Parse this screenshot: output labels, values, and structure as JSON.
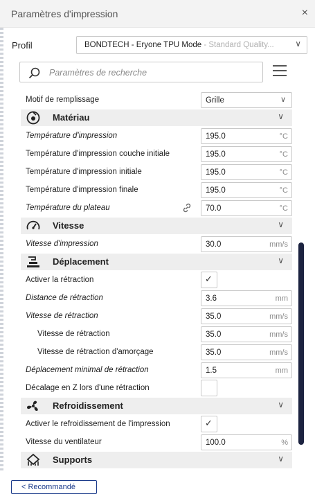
{
  "window": {
    "title": "Paramètres d'impression",
    "close_icon": "×"
  },
  "profile": {
    "label": "Profil",
    "name": "BONDTECH - Eryone TPU Mode",
    "quality": " - Standard Quality..."
  },
  "search": {
    "placeholder": "Paramètres de recherche"
  },
  "settings": {
    "infill_pattern": {
      "label": "Motif de remplissage",
      "value": "Grille"
    },
    "material": {
      "title": "Matériau",
      "rows": [
        {
          "label": "Température d'impression",
          "value": "195.0",
          "unit": "°C"
        },
        {
          "label": "Température d'impression couche initiale",
          "value": "195.0",
          "unit": "°C"
        },
        {
          "label": "Température d'impression initiale",
          "value": "195.0",
          "unit": "°C"
        },
        {
          "label": "Température d'impression finale",
          "value": "195.0",
          "unit": "°C"
        },
        {
          "label": "Température du plateau",
          "value": "70.0",
          "unit": "°C"
        }
      ]
    },
    "speed": {
      "title": "Vitesse",
      "rows": [
        {
          "label": "Vitesse d'impression",
          "value": "30.0",
          "unit": "mm/s"
        }
      ]
    },
    "travel": {
      "title": "Déplacement",
      "enable_retraction": {
        "label": "Activer la rétraction",
        "checked": true
      },
      "rows": [
        {
          "label": "Distance de rétraction",
          "value": "3.6",
          "unit": "mm"
        },
        {
          "label": "Vitesse de rétraction",
          "value": "35.0",
          "unit": "mm/s"
        },
        {
          "label": "Vitesse de rétraction",
          "value": "35.0",
          "unit": "mm/s"
        },
        {
          "label": "Vitesse de rétraction d'amorçage",
          "value": "35.0",
          "unit": "mm/s"
        },
        {
          "label": "Déplacement minimal de rétraction",
          "value": "1.5",
          "unit": "mm"
        }
      ],
      "zhop": {
        "label": "Décalage en Z lors d'une rétraction",
        "checked": false
      }
    },
    "cooling": {
      "title": "Refroidissement",
      "enable_cooling": {
        "label": "Activer le refroidissement de l'impression",
        "checked": true
      },
      "fan_speed": {
        "label": "Vitesse du ventilateur",
        "value": "100.0",
        "unit": "%"
      }
    },
    "supports": {
      "title": "Supports"
    }
  },
  "footer": {
    "recommended_button": "< Recommandé"
  },
  "colors": {
    "accent": "#1c2340",
    "category_bg": "#eeeeee",
    "border": "#c8c8c8"
  }
}
